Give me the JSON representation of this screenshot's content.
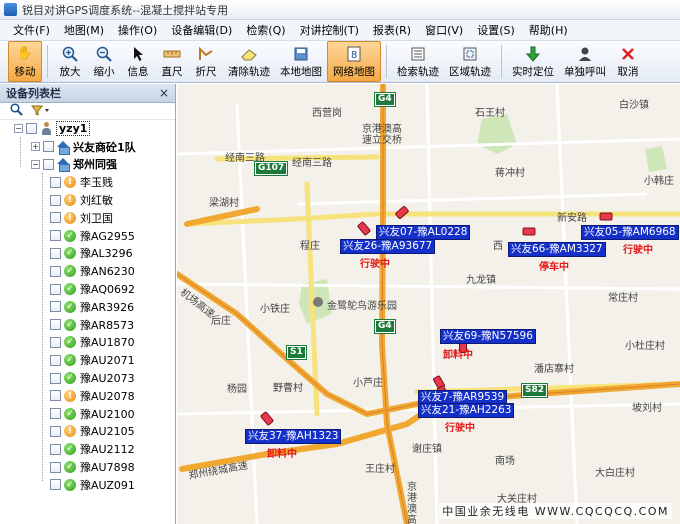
{
  "window": {
    "title": "锐目对讲GPS调度系统--混凝土搅拌站专用"
  },
  "menu": [
    "文件(F)",
    "地图(M)",
    "操作(O)",
    "设备编辑(D)",
    "检索(Q)",
    "对讲控制(T)",
    "报表(R)",
    "窗口(V)",
    "设置(S)",
    "帮助(H)"
  ],
  "toolbar": {
    "move": "移动",
    "zoom_in": "放大",
    "zoom_out": "缩小",
    "info": "信息",
    "ruler": "直尺",
    "polyline": "折尺",
    "clear_track": "清除轨迹",
    "local_map": "本地地图",
    "network_map": "网络地图",
    "search_track": "检索轨迹",
    "area_track": "区域轨迹",
    "realtime_locate": "实时定位",
    "single_call": "单独呼叫",
    "cancel": "取消"
  },
  "panel": {
    "title": "设备列表栏",
    "close": "×",
    "root": "yzy1",
    "groups": [
      {
        "name": "兴友商砼1队"
      },
      {
        "name": "郑州同强"
      }
    ],
    "devices": [
      {
        "name": "李玉贱",
        "status": "offline"
      },
      {
        "name": "刘红敏",
        "status": "offline"
      },
      {
        "name": "刘卫国",
        "status": "offline"
      },
      {
        "name": "豫AG2955",
        "status": "online"
      },
      {
        "name": "豫AL3296",
        "status": "online"
      },
      {
        "name": "豫AN6230",
        "status": "online"
      },
      {
        "name": "豫AQ0692",
        "status": "online"
      },
      {
        "name": "豫AR3926",
        "status": "online"
      },
      {
        "name": "豫AR8573",
        "status": "online"
      },
      {
        "name": "豫AU1870",
        "status": "online"
      },
      {
        "name": "豫AU2071",
        "status": "online"
      },
      {
        "name": "豫AU2073",
        "status": "online"
      },
      {
        "name": "豫AU2078",
        "status": "offline"
      },
      {
        "name": "豫AU2100",
        "status": "online"
      },
      {
        "name": "豫AU2105",
        "status": "offline"
      },
      {
        "name": "豫AU2112",
        "status": "online"
      },
      {
        "name": "豫AU7898",
        "status": "online"
      },
      {
        "name": "豫AUZ091",
        "status": "online"
      }
    ]
  },
  "map": {
    "places": [
      "西营岗",
      "石王村",
      "白沙镇",
      "京港澳高速立交桥",
      "经南三路",
      "经南三路",
      "梁湖村",
      "蒋冲村",
      "小韩庄",
      "新安路",
      "程庄",
      "九龙镇",
      "西",
      "后庄",
      "小铁庄",
      "金鹭鸵鸟游乐园",
      "常庄村",
      "杨园",
      "野曹村",
      "小芦庄",
      "潘店寨村",
      "小杜庄村",
      "谢庄镇",
      "南场",
      "王庄村",
      "坡刘村",
      "大白庄村",
      "大关庄村",
      "京港澳高",
      "机场高速",
      "郑州绕城高速"
    ],
    "routes": [
      "G4",
      "G107",
      "G4",
      "S1",
      "S82"
    ],
    "vehicles": [
      {
        "label": "兴友07-豫AL0228",
        "status": ""
      },
      {
        "label": "兴友26-豫A93677",
        "status": "行驶中"
      },
      {
        "label": "兴友66-豫AM3327",
        "status": "停车中"
      },
      {
        "label": "兴友05-豫AM6968",
        "status": "行驶中"
      },
      {
        "label": "兴友69-豫N57596",
        "status": "卸料中"
      },
      {
        "label": "兴友7-豫AR9539",
        "status": ""
      },
      {
        "label": "兴友21-豫AH2263",
        "status": "行驶中"
      },
      {
        "label": "兴友37-豫AH1323",
        "status": "卸料中"
      }
    ]
  },
  "watermark": "中国业余无线电 WWW.CQCQCQ.COM",
  "colors": {
    "vehicle_label_bg": "#1430c8",
    "status_text": "#e21a1a",
    "online": "#2f9c1f",
    "offline": "#e88a12",
    "active_tool": "#f4a945"
  }
}
